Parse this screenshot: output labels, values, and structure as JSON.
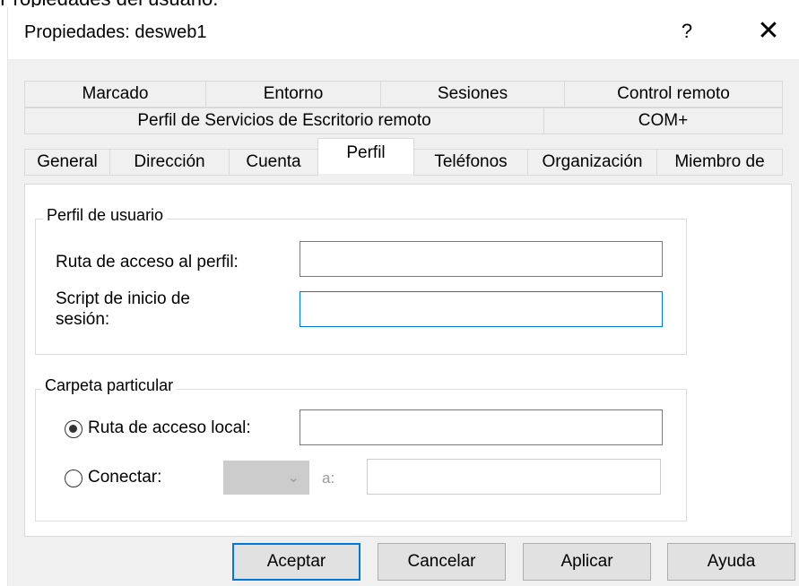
{
  "background_caption": "Propiedades del usuario.",
  "window": {
    "title": "Propiedades: desweb1",
    "help_glyph": "?",
    "close_glyph": "✕"
  },
  "tabs": {
    "row1": [
      "Marcado",
      "Entorno",
      "Sesiones",
      "Control remoto"
    ],
    "row2": [
      "Perfil de Servicios de Escritorio remoto",
      "COM+"
    ],
    "row3": [
      "General",
      "Dirección",
      "Cuenta",
      "Perfil",
      "Teléfonos",
      "Organización",
      "Miembro de"
    ],
    "selected": "Perfil"
  },
  "perfil_usuario": {
    "legend": "Perfil de usuario",
    "ruta_label": "Ruta de acceso al perfil:",
    "ruta_value": "",
    "script_label_line1": "Script de inicio de",
    "script_label_line2": "sesión:",
    "script_value": ""
  },
  "carpeta": {
    "legend": "Carpeta particular",
    "local_label": "Ruta de acceso local:",
    "local_checked": true,
    "local_value": "",
    "conectar_label": "Conectar:",
    "conectar_checked": false,
    "drive_value": "",
    "a_label": "a:",
    "conectar_value": ""
  },
  "buttons": {
    "ok": "Aceptar",
    "cancel": "Cancelar",
    "apply": "Aplicar",
    "help": "Ayuda"
  },
  "colors": {
    "focus_accent": "#0078d7",
    "dialog_bg": "#f0f0f0"
  }
}
